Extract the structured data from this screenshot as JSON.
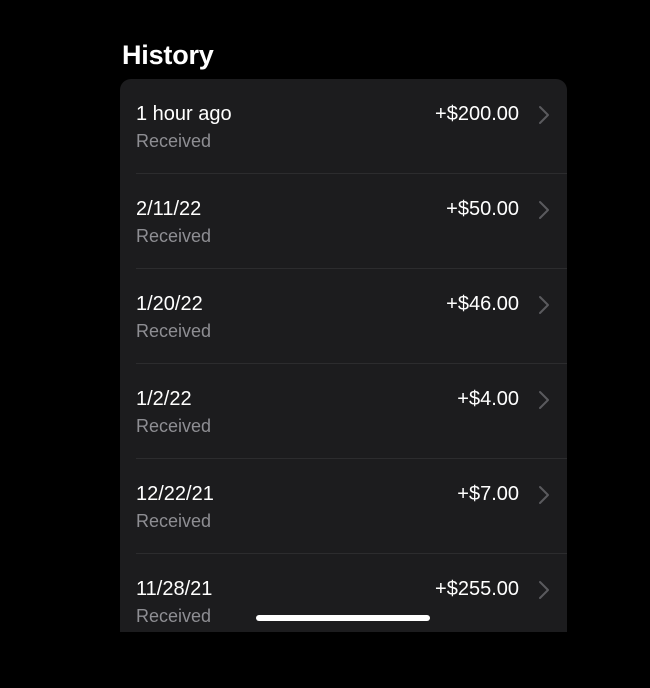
{
  "header": {
    "title": "History"
  },
  "history": {
    "items": [
      {
        "date": "1 hour ago",
        "status": "Received",
        "amount": "+$200.00"
      },
      {
        "date": "2/11/22",
        "status": "Received",
        "amount": "+$50.00"
      },
      {
        "date": "1/20/22",
        "status": "Received",
        "amount": "+$46.00"
      },
      {
        "date": "1/2/22",
        "status": "Received",
        "amount": "+$4.00"
      },
      {
        "date": "12/22/21",
        "status": "Received",
        "amount": "+$7.00"
      },
      {
        "date": "11/28/21",
        "status": "Received",
        "amount": "+$255.00"
      }
    ],
    "row_icon": "chevron-right-icon"
  },
  "colors": {
    "background": "#000000",
    "card": "#1c1c1e",
    "primary_text": "#ffffff",
    "secondary_text": "#8e8e93",
    "chevron": "#5a5a5e",
    "divider": "#2c2c2e"
  }
}
